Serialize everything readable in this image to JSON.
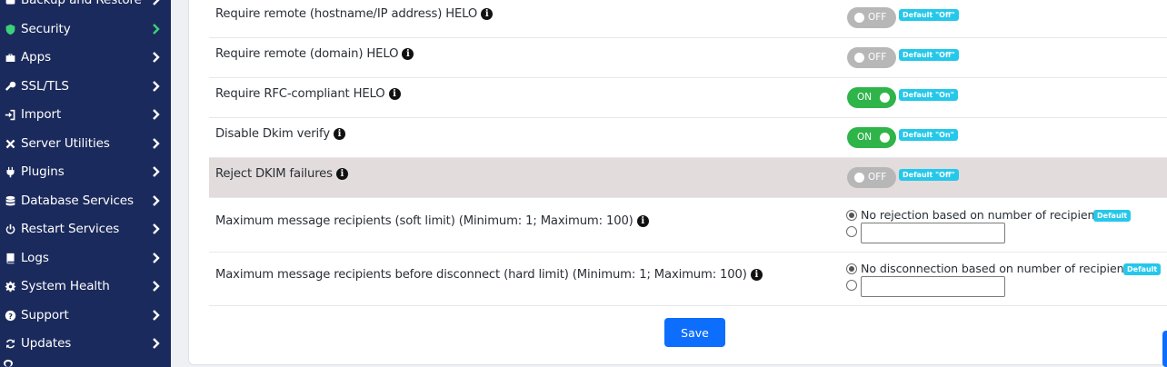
{
  "sidebar": {
    "items": [
      {
        "label": "Backup and Restore",
        "icon": "backup-icon"
      },
      {
        "label": "Security",
        "icon": "shield-icon",
        "active": true
      },
      {
        "label": "Apps",
        "icon": "briefcase-icon"
      },
      {
        "label": "SSL/TLS",
        "icon": "key-icon"
      },
      {
        "label": "Import",
        "icon": "import-icon"
      },
      {
        "label": "Server Utilities",
        "icon": "tools-icon"
      },
      {
        "label": "Plugins",
        "icon": "plug-icon"
      },
      {
        "label": "Database Services",
        "icon": "database-icon"
      },
      {
        "label": "Restart Services",
        "icon": "power-icon"
      },
      {
        "label": "Logs",
        "icon": "book-icon"
      },
      {
        "label": "System Health",
        "icon": "gear-icon"
      },
      {
        "label": "Support",
        "icon": "question-icon"
      },
      {
        "label": "Updates",
        "icon": "refresh-icon"
      }
    ],
    "accent_color": "#3dd07a",
    "background_color": "#1b2a5c"
  },
  "settings": {
    "toggles": [
      {
        "label": "Require remote (hostname/IP address) HELO",
        "state": "OFF",
        "badge": "Default \"Off\""
      },
      {
        "label": "Require remote (domain) HELO",
        "state": "OFF",
        "badge": "Default \"Off\""
      },
      {
        "label": "Require RFC-compliant HELO",
        "state": "ON",
        "badge": "Default \"On\""
      },
      {
        "label": "Disable Dkim verify",
        "state": "ON",
        "badge": "Default \"On\""
      },
      {
        "label": "Reject DKIM failures",
        "state": "OFF",
        "badge": "Default \"Off\""
      }
    ],
    "limits": [
      {
        "label": "Maximum message recipients (soft limit) (Minimum: 1; Maximum: 100)",
        "option_label": "No rejection based on number of recipients",
        "badge": "Default",
        "input_value": ""
      },
      {
        "label": "Maximum message recipients before disconnect (hard limit) (Minimum: 1; Maximum: 100)",
        "option_label": "No disconnection based on number of recipients",
        "badge": "Default",
        "input_value": ""
      }
    ]
  },
  "footer": {
    "save_label": "Save"
  },
  "colors": {
    "toggle_on": "#2fb44a",
    "toggle_off": "#b7b7b7",
    "badge": "#25c8ea",
    "primary": "#0d6efd",
    "highlight_row": "#e2dcdc"
  }
}
